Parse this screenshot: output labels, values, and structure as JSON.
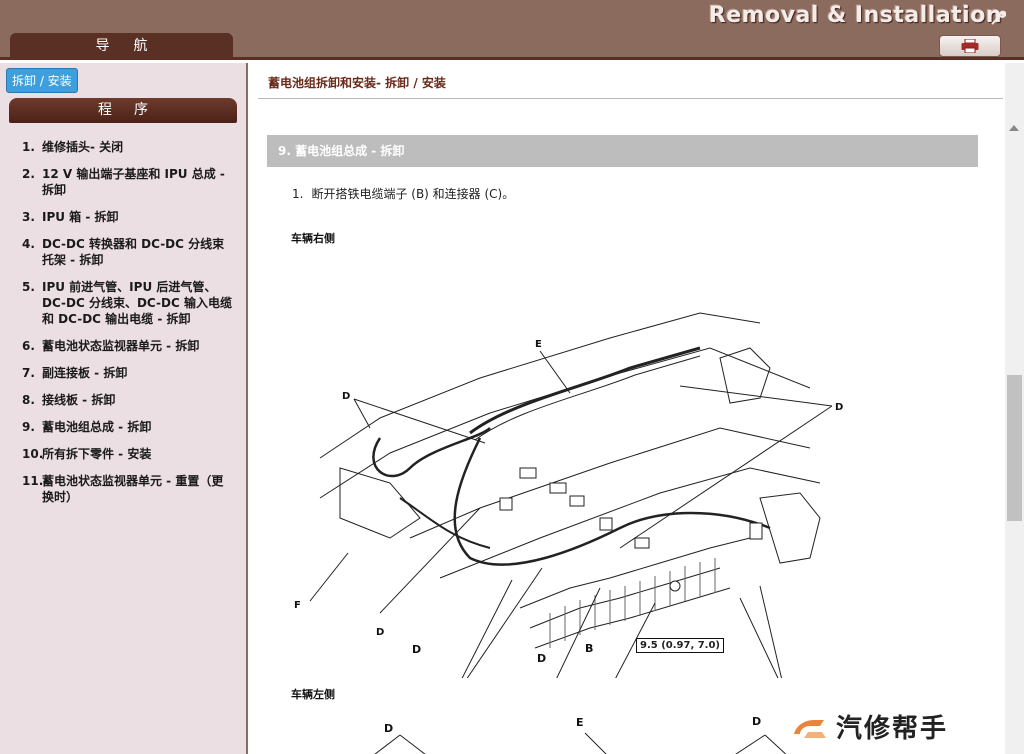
{
  "header": {
    "banner_title": "Removal & Installation",
    "nav_tab": "导航",
    "print_icon": "printer-icon"
  },
  "sidebar": {
    "active_tab": "拆卸 / 安装",
    "procedure_header": "程序",
    "steps": [
      {
        "num": "1.",
        "label": "维修插头- 关闭"
      },
      {
        "num": "2.",
        "label": "12 V 输出端子基座和 IPU 总成 - 拆卸"
      },
      {
        "num": "3.",
        "label": "IPU 箱 - 拆卸"
      },
      {
        "num": "4.",
        "label": "DC-DC 转换器和 DC-DC 分线束托架 - 拆卸"
      },
      {
        "num": "5.",
        "label": "IPU 前进气管、IPU 后进气管、DC-DC 分线束、DC-DC 输入电缆和 DC-DC 输出电缆 - 拆卸"
      },
      {
        "num": "6.",
        "label": "蓄电池状态监视器单元 - 拆卸"
      },
      {
        "num": "7.",
        "label": "副连接板 - 拆卸"
      },
      {
        "num": "8.",
        "label": "接线板 - 拆卸"
      },
      {
        "num": "9.",
        "label": "蓄电池组总成 - 拆卸"
      },
      {
        "num": "10.",
        "label": "所有拆下零件 - 安装"
      },
      {
        "num": "11.",
        "label": "蓄电池状态监视器单元 - 重置（更换时）"
      }
    ]
  },
  "main": {
    "page_title": "蓄电池组拆卸和安装- 拆卸 / 安装",
    "section_title": "9. 蓄电池组总成 - 拆卸",
    "step_number": "1.",
    "step_text": "断开搭铁电缆端子 (B) 和连接器 (C)。",
    "right_side_label": "车辆右侧",
    "left_side_label": "车辆左侧",
    "diagram_labels": {
      "e": "E",
      "d": "D",
      "f": "F",
      "b": "B"
    },
    "torque": "9.5 (0.97, 7.0)"
  },
  "watermark": {
    "text": "汽修帮手"
  }
}
